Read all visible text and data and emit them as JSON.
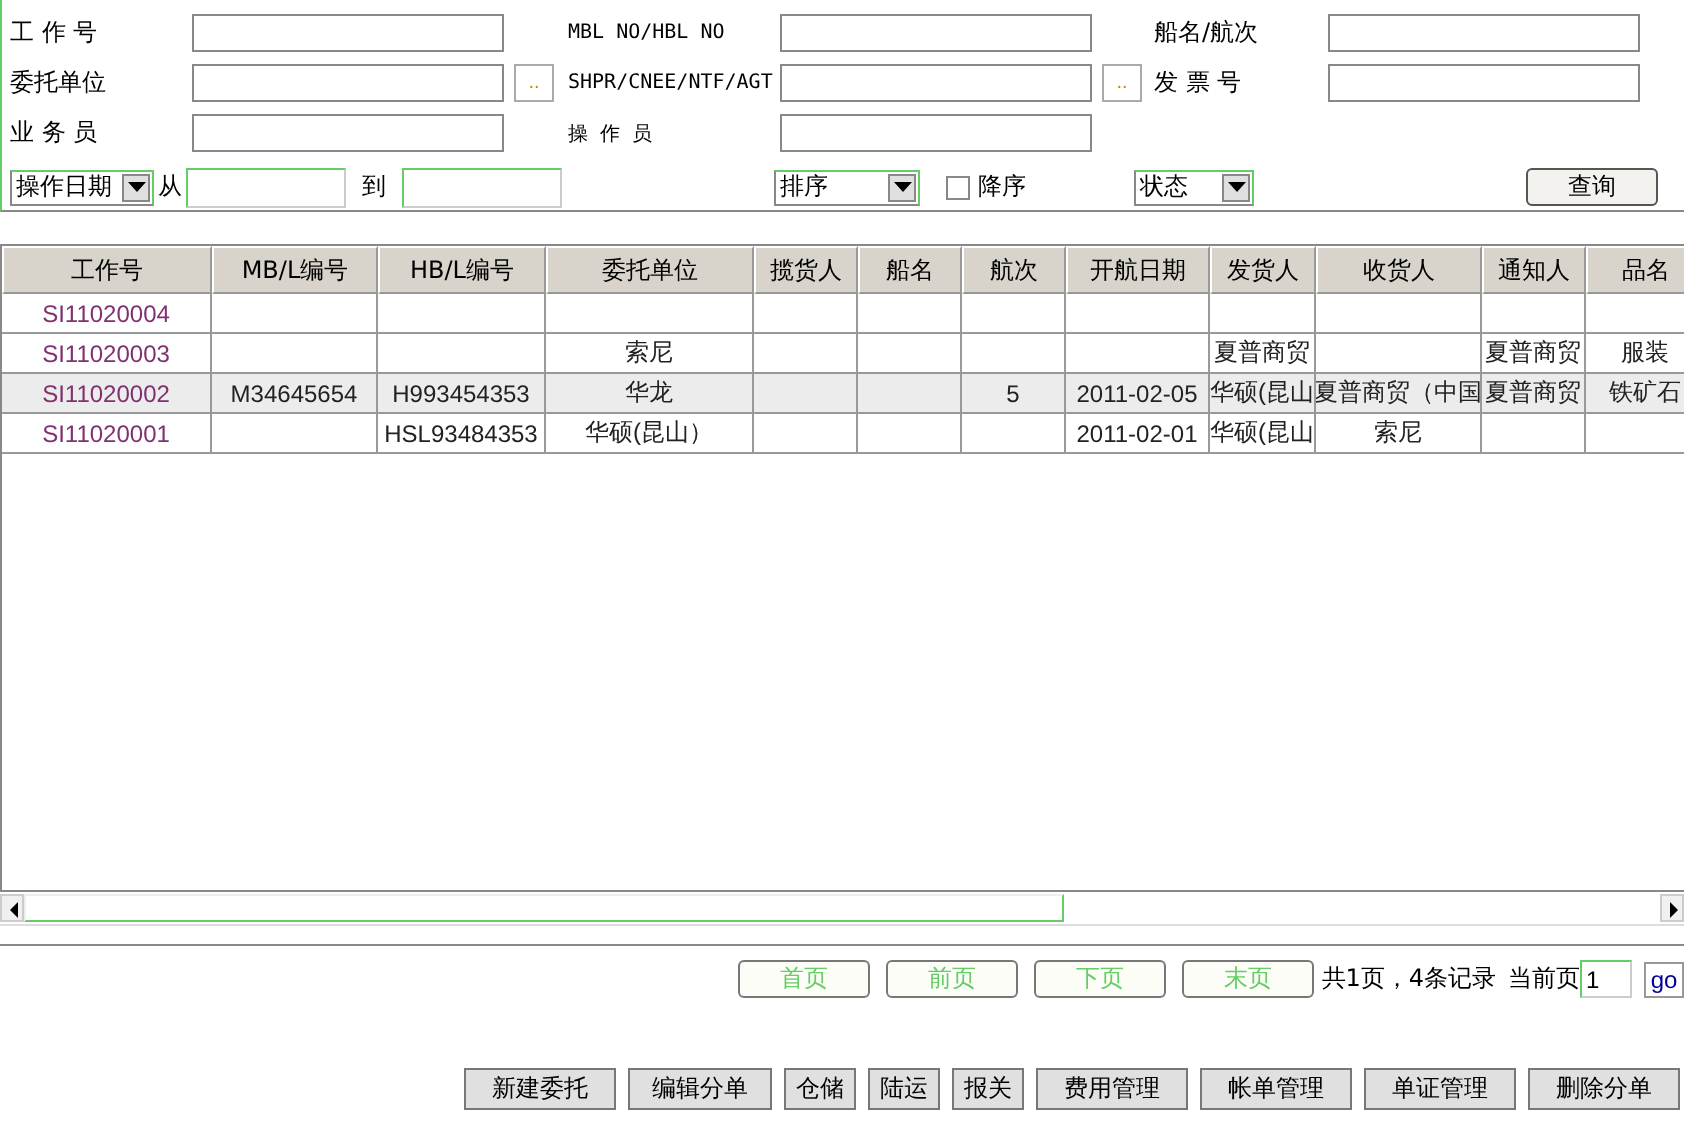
{
  "search_form": {
    "rows": [
      {
        "fields": [
          {
            "label": "工 作 号",
            "picker": false
          },
          {
            "label": "MBL NO/HBL NO",
            "picker": false
          },
          {
            "label": "船名/航次",
            "picker": false
          }
        ]
      },
      {
        "fields": [
          {
            "label": "委托单位",
            "picker": true,
            "picker_label": ".."
          },
          {
            "label": "SHPR/CNEE/NTF/AGT",
            "picker": true,
            "picker_label": ".."
          },
          {
            "label": "发 票 号",
            "picker": false
          }
        ]
      },
      {
        "fields": [
          {
            "label": "业 务 员",
            "picker": false
          },
          {
            "label": "操 作 员",
            "picker": false
          }
        ]
      }
    ],
    "date_select": "操作日期",
    "from_label": "从",
    "to_label": "到",
    "sort_select": "排序",
    "descending": {
      "label": "降序",
      "checked": false
    },
    "status_select": "状态",
    "query_button": "查询"
  },
  "table": {
    "columns": [
      "工作号",
      "MB/L编号",
      "HB/L编号",
      "委托单位",
      "揽货人",
      "船名",
      "航次",
      "开航日期",
      "发货人",
      "收货人",
      "通知人",
      "品名"
    ],
    "rows": [
      {
        "selected": false,
        "cells": [
          "SI11020004",
          "",
          "",
          "",
          "",
          "",
          "",
          "",
          "",
          "",
          "",
          ""
        ]
      },
      {
        "selected": false,
        "cells": [
          "SI11020003",
          "",
          "",
          "索尼",
          "",
          "",
          "",
          "",
          "夏普商贸",
          "",
          "夏普商贸",
          "服装"
        ]
      },
      {
        "selected": true,
        "cells": [
          "SI11020002",
          "M34645654",
          "H993454353",
          "华龙",
          "",
          "",
          "5",
          "2011-02-05",
          "华硕(昆山",
          "夏普商贸（中国",
          "夏普商贸",
          "铁矿石"
        ]
      },
      {
        "selected": false,
        "cells": [
          "SI11020001",
          "",
          "HSL93484353",
          "华硕(昆山）",
          "",
          "",
          "",
          "2011-02-01",
          "华硕(昆山",
          "索尼",
          "",
          ""
        ]
      }
    ]
  },
  "pager": {
    "buttons": [
      "首页",
      "前页",
      "下页",
      "末页"
    ],
    "summary": "共1页，4条记录",
    "current_label": "当前页",
    "current_page": "1",
    "go_button": "go"
  },
  "actions": [
    "新建委托",
    "编辑分单",
    "仓储",
    "陆运",
    "报关",
    "费用管理",
    "帐单管理",
    "单证管理",
    "删除分单"
  ]
}
